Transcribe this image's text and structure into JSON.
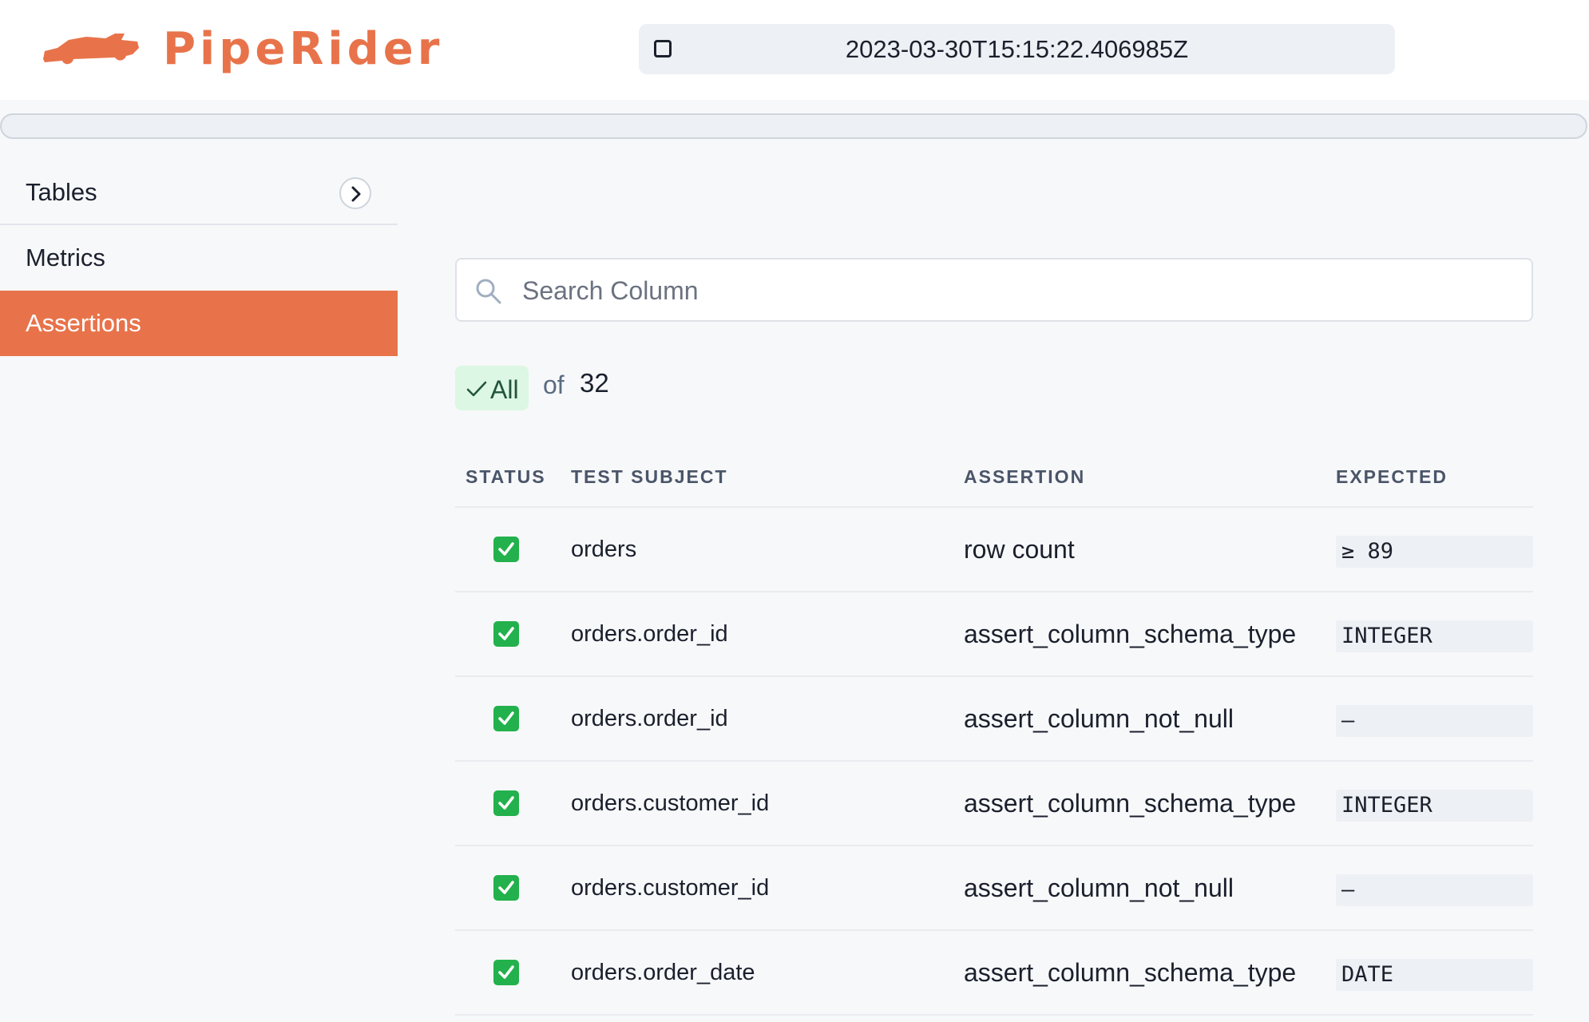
{
  "header": {
    "logo_text": "PipeRider",
    "run_timestamp": "2023-03-30T15:15:22.406985Z"
  },
  "sidebar": {
    "items": [
      {
        "label": "Tables",
        "active": false
      },
      {
        "label": "Metrics",
        "active": false
      },
      {
        "label": "Assertions",
        "active": true
      }
    ]
  },
  "search": {
    "placeholder": "Search Column",
    "value": ""
  },
  "filter": {
    "chip_label": "All",
    "of_label": "of",
    "total": "32"
  },
  "table": {
    "columns": [
      "STATUS",
      "TEST SUBJECT",
      "ASSERTION",
      "EXPECTED"
    ],
    "rows": [
      {
        "status": "passed",
        "subject": "orders",
        "assertion": "row count",
        "expected": "≥ 89"
      },
      {
        "status": "passed",
        "subject": "orders.order_id",
        "assertion": "assert_column_schema_type",
        "expected": "INTEGER"
      },
      {
        "status": "passed",
        "subject": "orders.order_id",
        "assertion": "assert_column_not_null",
        "expected": "–"
      },
      {
        "status": "passed",
        "subject": "orders.customer_id",
        "assertion": "assert_column_schema_type",
        "expected": "INTEGER"
      },
      {
        "status": "passed",
        "subject": "orders.customer_id",
        "assertion": "assert_column_not_null",
        "expected": "–"
      },
      {
        "status": "passed",
        "subject": "orders.order_date",
        "assertion": "assert_column_schema_type",
        "expected": "DATE"
      }
    ]
  },
  "colors": {
    "brand": "#e8734a",
    "pass": "#22b14c",
    "chip_bg": "#dcf7e3"
  },
  "icons": [
    "car-logo-icon",
    "checkbox-icon",
    "chevron-right-icon",
    "search-icon",
    "check-icon",
    "status-pass-icon"
  ]
}
